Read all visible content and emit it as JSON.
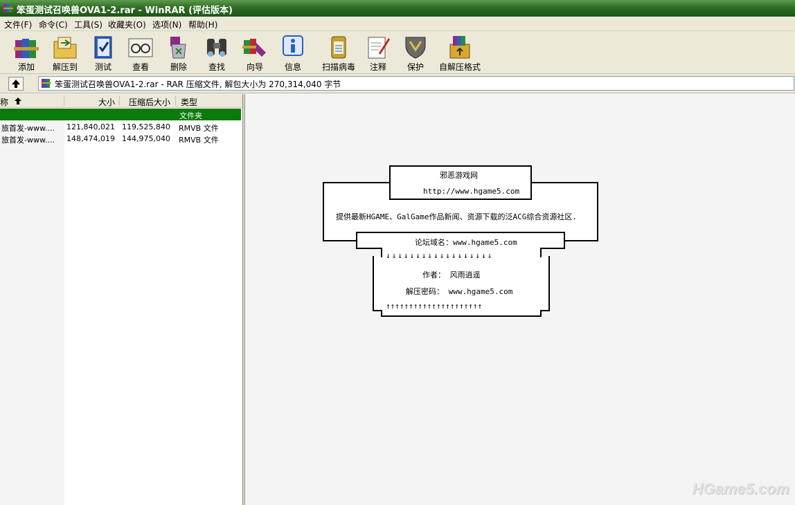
{
  "window": {
    "title": "笨蛋测试召唤兽OVA1-2.rar - WinRAR (评估版本)"
  },
  "menu": [
    {
      "label": "文件(F)"
    },
    {
      "label": "命令(C)"
    },
    {
      "label": "工具(S)"
    },
    {
      "label": "收藏夹(O)"
    },
    {
      "label": "选项(N)"
    },
    {
      "label": "帮助(H)"
    }
  ],
  "toolbar": [
    {
      "label": "添加",
      "icon": "add-books-icon"
    },
    {
      "label": "解压到",
      "icon": "extract-folder-icon"
    },
    {
      "label": "测试",
      "icon": "test-book-icon"
    },
    {
      "label": "查看",
      "icon": "view-glasses-icon"
    },
    {
      "label": "删除",
      "icon": "delete-recycle-icon"
    },
    {
      "label": "查找",
      "icon": "binoculars-icon"
    },
    {
      "label": "向导",
      "icon": "wizard-icon"
    },
    {
      "label": "信息",
      "icon": "info-icon"
    },
    {
      "label": "扫描病毒",
      "icon": "virus-scan-icon"
    },
    {
      "label": "注释",
      "icon": "comment-pen-icon"
    },
    {
      "label": "保护",
      "icon": "shield-icon"
    },
    {
      "label": "自解压格式",
      "icon": "sfx-box-icon"
    }
  ],
  "address": {
    "text": "笨蛋测试召唤兽OVA1-2.rar - RAR 压缩文件, 解包大小为 270,314,040 字节"
  },
  "file_list": {
    "headers": {
      "name": "称",
      "size": "大小",
      "packed": "压缩后大小",
      "type": "类型"
    },
    "rows": [
      {
        "name": "",
        "size": "",
        "packed": "",
        "type": "文件夹",
        "selected": true
      },
      {
        "name": "旅首发-www....",
        "size": "121,840,021",
        "packed": "119,525,840",
        "type": "RMVB 文件",
        "selected": false
      },
      {
        "name": "旅首发-www....",
        "size": "148,474,019",
        "packed": "144,975,040",
        "type": "RMVB 文件",
        "selected": false
      }
    ]
  },
  "comment": {
    "site_name": "邪恶游戏网",
    "site_url": "http://www.hgame5.com",
    "description": "提供最新HGAME、GalGame作品新闻、资源下载的泛ACG综合资源社区.",
    "forum": "论坛域名：www.hgame5.com",
    "arrows_down": "↓↓↓↓↓↓↓↓↓↓↓↓↓↓↓↓↓↓",
    "author": "作者：    风雨逍遥",
    "password": "解压密码：  www.hgame5.com",
    "arrows_up": "↑↑↑↑↑↑↑↑↑↑↑↑↑↑↑↑↑↑↑↑↑"
  },
  "watermark": "HGame5.com",
  "colors": {
    "title_green": "#2f6d25",
    "selected_row": "#0a7a0a",
    "chrome": "#ece9d8"
  }
}
